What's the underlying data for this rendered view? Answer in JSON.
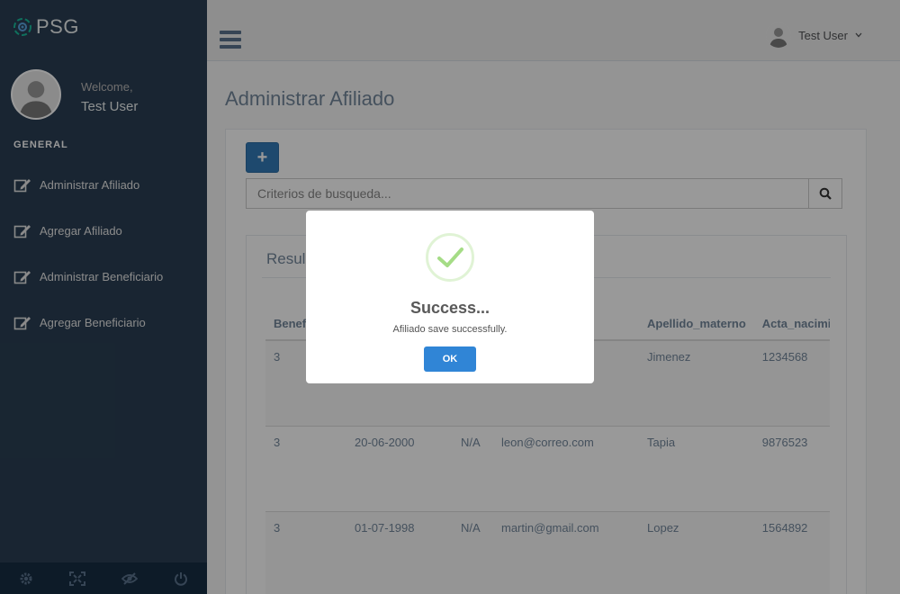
{
  "brand": {
    "name": "PSG"
  },
  "sidebar": {
    "welcome": "Welcome,",
    "username": "Test User",
    "section_title": "GENERAL",
    "items": [
      {
        "label": "Administrar Afiliado",
        "icon": "edit-icon"
      },
      {
        "label": "Agregar Afiliado",
        "icon": "edit-icon"
      },
      {
        "label": "Administrar Beneficiario",
        "icon": "edit-icon"
      },
      {
        "label": "Agregar Beneficiario",
        "icon": "edit-icon"
      }
    ],
    "footer_icons": [
      "settings-icon",
      "fullscreen-icon",
      "lock-icon",
      "logout-icon"
    ]
  },
  "topnav": {
    "user_label": "Test User",
    "menu_icon": "hamburger-icon"
  },
  "main": {
    "page_title": "Administrar Afiliado",
    "add_label": "+",
    "search": {
      "placeholder": "Criterios de busqueda...",
      "icon": "search-icon"
    },
    "results_title": "Resul"
  },
  "table": {
    "headers": [
      "Benef",
      "",
      "",
      "",
      "Apellido_materno",
      "Acta_nacimi"
    ],
    "rows": [
      [
        "3",
        "",
        "",
        "",
        "Jimenez",
        "1234568"
      ],
      [
        "3",
        "20-06-2000",
        "N/A",
        "leon@correo.com",
        "Tapia",
        "9876523"
      ],
      [
        "3",
        "01-07-1998",
        "N/A",
        "martin@gmail.com",
        "Lopez",
        "1564892"
      ]
    ]
  },
  "modal": {
    "title": "Success...",
    "message": "Afiliado save successfully.",
    "ok_label": "OK",
    "icon": "success-check-icon"
  },
  "colors": {
    "sidebar_bg": "#2a3f54",
    "sidebar_footer": "#172d44",
    "primary": "#337ab7",
    "ok_button": "#3085d6",
    "success": "#a5dc86",
    "text_muted": "#73879c"
  }
}
